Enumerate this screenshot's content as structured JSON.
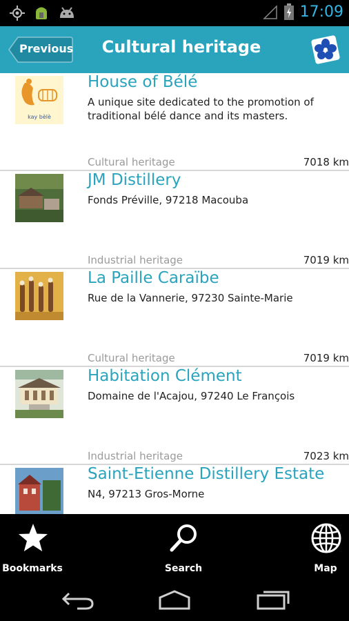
{
  "status_bar": {
    "time": "17:09"
  },
  "header": {
    "previous_label": "Previous",
    "title": "Cultural heritage"
  },
  "items": [
    {
      "title": "House of Bélé",
      "description": "A unique site dedicated to the promotion of traditional bélé dance and its masters.",
      "category": "Cultural heritage",
      "distance": "7018 km",
      "thumb_text": "kay bèlè"
    },
    {
      "title": "JM Distillery",
      "description": "Fonds Préville, 97218 Macouba",
      "category": "Industrial heritage",
      "distance": "7019 km"
    },
    {
      "title": "La Paille Caraïbe",
      "description": "Rue de la Vannerie, 97230 Sainte-Marie",
      "category": "Cultural heritage",
      "distance": "7019 km"
    },
    {
      "title": "Habitation Clément",
      "description": "Domaine de l'Acajou, 97240 Le François",
      "category": "Industrial heritage",
      "distance": "7023 km"
    },
    {
      "title": "Saint-Etienne Distillery Estate",
      "description": "N4, 97213 Gros-Morne",
      "category": "",
      "distance": ""
    }
  ],
  "tabs": {
    "bookmarks": "Bookmarks",
    "search": "Search",
    "map": "Map"
  },
  "colors": {
    "accent": "#2aa3bd",
    "clock": "#33b5e5",
    "divider": "#d6d6d6"
  }
}
